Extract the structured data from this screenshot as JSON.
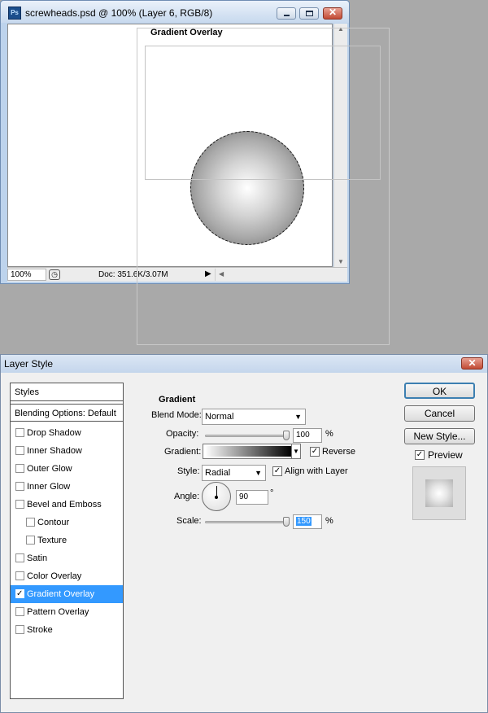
{
  "document_window": {
    "title": "screwheads.psd @ 100% (Layer 6, RGB/8)",
    "app_icon": "Ps",
    "zoom": "100%",
    "doc_size": "Doc: 351.6K/3.07M",
    "icons": [
      "photoshop-icon",
      "minimize-icon",
      "maximize-icon",
      "close-icon",
      "scroll-up-icon",
      "scroll-down-icon",
      "scroll-left-icon",
      "menu-arrow-icon"
    ]
  },
  "layer_style": {
    "title": "Layer Style",
    "close_glyph": "✕",
    "styles_header": "Styles",
    "blending_options": "Blending Options: Default",
    "style_items": [
      {
        "label": "Drop Shadow",
        "checked": false,
        "sub": false
      },
      {
        "label": "Inner Shadow",
        "checked": false,
        "sub": false
      },
      {
        "label": "Outer Glow",
        "checked": false,
        "sub": false
      },
      {
        "label": "Inner Glow",
        "checked": false,
        "sub": false
      },
      {
        "label": "Bevel and Emboss",
        "checked": false,
        "sub": false
      },
      {
        "label": "Contour",
        "checked": false,
        "sub": true
      },
      {
        "label": "Texture",
        "checked": false,
        "sub": true
      },
      {
        "label": "Satin",
        "checked": false,
        "sub": false
      },
      {
        "label": "Color Overlay",
        "checked": false,
        "sub": false
      },
      {
        "label": "Gradient Overlay",
        "checked": true,
        "sub": false,
        "selected": true
      },
      {
        "label": "Pattern Overlay",
        "checked": false,
        "sub": false
      },
      {
        "label": "Stroke",
        "checked": false,
        "sub": false
      }
    ],
    "section_title": "Gradient Overlay",
    "group_title": "Gradient",
    "blend_mode_label": "Blend Mode:",
    "blend_mode_value": "Normal",
    "opacity_label": "Opacity:",
    "opacity_value": "100",
    "opacity_level": 100,
    "percent": "%",
    "gradient_label": "Gradient:",
    "reverse_label": "Reverse",
    "reverse_checked": true,
    "style_label": "Style:",
    "style_value": "Radial",
    "align_label": "Align with Layer",
    "align_checked": true,
    "angle_label": "Angle:",
    "angle_value": "90",
    "degree": "°",
    "scale_label": "Scale:",
    "scale_value": "150",
    "scale_level": 150,
    "buttons": {
      "ok": "OK",
      "cancel": "Cancel",
      "new_style": "New Style..."
    },
    "preview_label": "Preview",
    "preview_checked": true,
    "check_glyph": "✓",
    "colors": {
      "selection_blue": "#3399ff",
      "default_button_border": "#3c7fb1",
      "close_red": "#c24a34"
    }
  }
}
